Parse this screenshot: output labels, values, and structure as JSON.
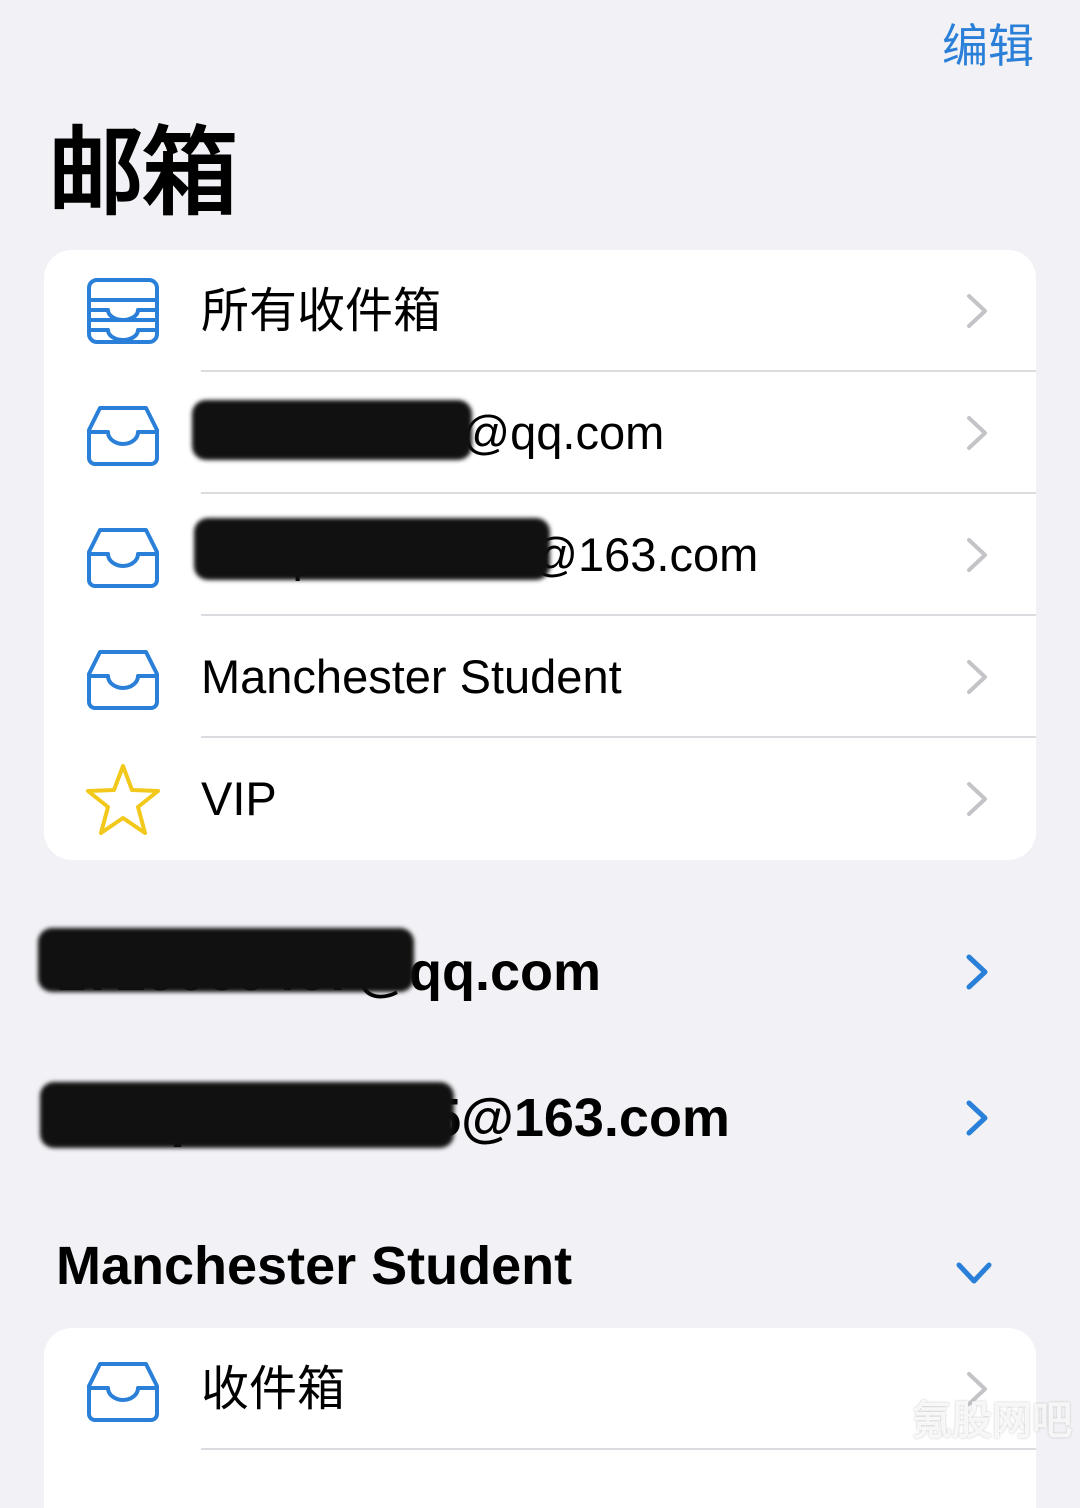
{
  "header": {
    "edit_label": "编辑",
    "title": "邮箱"
  },
  "mailboxes": [
    {
      "label": "所有收件箱",
      "icon": "all-inboxes-icon"
    },
    {
      "label": "1729060467@qq.com",
      "icon": "inbox-icon"
    },
    {
      "label": "chuqiaocui0125@163.com",
      "icon": "inbox-icon"
    },
    {
      "label": "Manchester Student",
      "icon": "inbox-icon"
    },
    {
      "label": "VIP",
      "icon": "star-icon"
    }
  ],
  "accounts": [
    {
      "title": "1729060467@qq.com",
      "expanded": false
    },
    {
      "title": "chuqiaocui0125@163.com",
      "expanded": false
    },
    {
      "title": "Manchester Student",
      "expanded": true
    }
  ],
  "manchester_folders": [
    {
      "label": "收件箱",
      "icon": "inbox-icon"
    }
  ],
  "watermark": "氪股网吧",
  "colors": {
    "accent": "#2a80d8",
    "background": "#f2f2f6",
    "card": "#ffffff",
    "star": "#f2c81a",
    "chevron_gray": "#c4c4c8"
  }
}
